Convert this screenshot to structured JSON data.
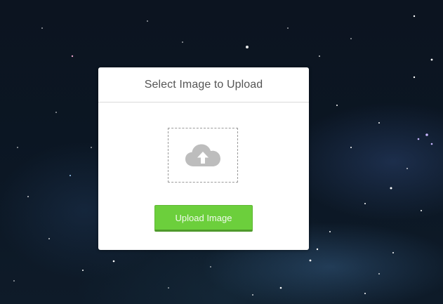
{
  "modal": {
    "title": "Select Image to Upload",
    "drop_zone_icon": "cloud-upload-icon",
    "upload_button_label": "Upload Image"
  },
  "colors": {
    "button_green": "#6ccf3c",
    "icon_gray": "#bdbdbd",
    "title_gray": "#555555",
    "background": "#0b1623"
  }
}
